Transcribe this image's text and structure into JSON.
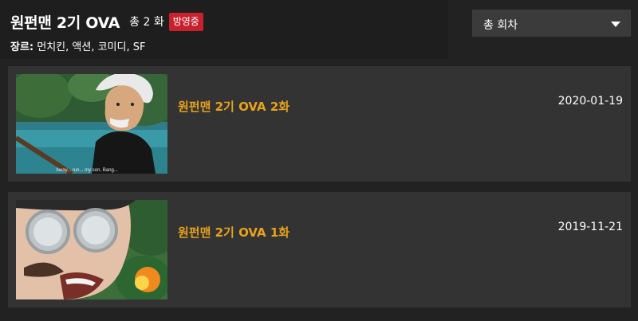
{
  "header": {
    "title": "원펀맨 2기 OVA",
    "episode_count": "총 2 화",
    "status": "방영중",
    "genre_label": "장르:",
    "genres": "먼치킨, 액션, 코미디, SF"
  },
  "sort": {
    "selected": "총 회차",
    "icon": "chevron-down-icon"
  },
  "episodes": [
    {
      "title": "원펀맨 2기 OVA 2화",
      "date": "2020-01-19",
      "thumbnail_caption": "Away... run... my son, Bang..."
    },
    {
      "title": "원펀맨 2기 OVA 1화",
      "date": "2019-11-21"
    }
  ],
  "colors": {
    "episode_title": "#e8a21c",
    "status_badge": "#c8202c",
    "card_bg": "#333333"
  }
}
